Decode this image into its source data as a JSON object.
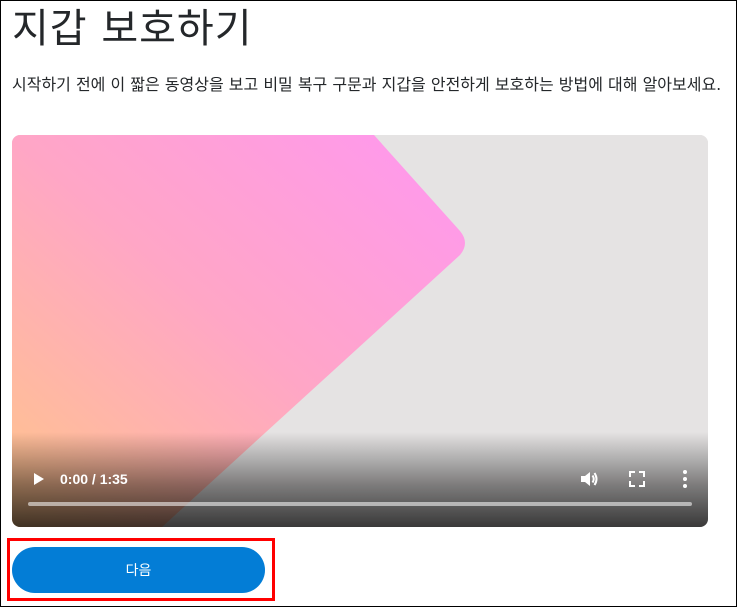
{
  "page": {
    "title": "지갑 보호하기",
    "description": "시작하기 전에 이 짧은 동영상을 보고 비밀 복구 구문과 지갑을 안전하게 보호하는 방법에 대해 알아보세요."
  },
  "video": {
    "time": "0:00 / 1:35",
    "progress_fraction": 0,
    "controls": {
      "play": "play-icon",
      "volume": "volume-icon",
      "fullscreen": "fullscreen-icon",
      "more": "more-options-icon"
    }
  },
  "actions": {
    "next_label": "다음"
  },
  "colors": {
    "text": "#24272a",
    "primary_button": "#037dd6",
    "highlight_border": "#ff0000",
    "video_background": "#e5e3e3",
    "gradient_pink": "#ff9bf0",
    "gradient_peach": "#ffc08a"
  }
}
